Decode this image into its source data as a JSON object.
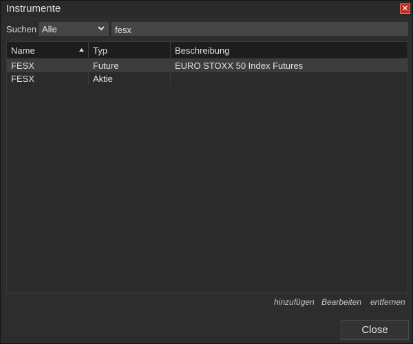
{
  "window": {
    "title": "Instrumente",
    "close_glyph": "✕"
  },
  "search": {
    "label": "Suchen",
    "type_selected": "Alle",
    "query": "fesx"
  },
  "grid": {
    "columns": [
      "Name",
      "Typ",
      "Beschreibung"
    ],
    "sort_column": "Name",
    "sort_direction": "ascending",
    "rows": [
      {
        "name": "FESX",
        "type": "Future",
        "description": "EURO STOXX 50 Index Futures",
        "selected": true
      },
      {
        "name": "FESX",
        "type": "Aktie",
        "description": "",
        "selected": false
      }
    ]
  },
  "actions": {
    "add": "hinzufügen",
    "edit": "Bearbeiten",
    "remove": "entfernen"
  },
  "footer": {
    "close_label": "Close"
  },
  "colors": {
    "background": "#2d2d2d",
    "header_bg": "#1d1d1d",
    "selected_row": "#3d3d3d",
    "close_red": "#c42b1c"
  }
}
